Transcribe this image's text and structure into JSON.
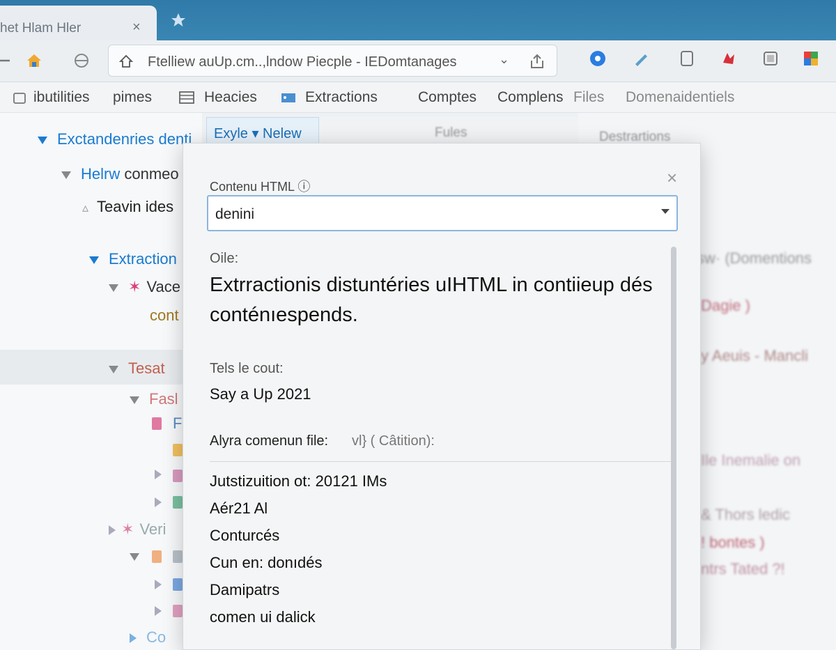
{
  "browser": {
    "tab_title": "het Hlam Hler",
    "tab_close": "×",
    "address": "Ftelliew auUp.cm..,lndow Piecple - IEDomtanages",
    "address_chevron": "⌄"
  },
  "bookmarks": [
    "ibutilities",
    "pimes",
    "Heacies",
    "Extractions",
    "Comptes",
    "Complens",
    "Files",
    "Domenaidentiels"
  ],
  "tree": {
    "item1": "Exctandenries denti",
    "item2_prefix": "Helrw",
    "item2_rest": " conmeo",
    "item3": "Teavin ides",
    "item4": "Extraction",
    "item5": "Vace",
    "item6": "cont",
    "item7": "Tesat",
    "item8": "Fasl",
    "item9": "F",
    "item10": "Veri",
    "item11": "Co"
  },
  "toolbar": {
    "dialog_tab": "Exyle ▾ Nelew",
    "files": "Fules",
    "destinations": "Destrartions"
  },
  "right_panel": {
    "line1": "sw· (Domentions",
    "line2": "Dagie )",
    "line3": "y Aeuis - Mancli",
    "line4": "Ile Inemalie on",
    "line5": "& Thors ledic",
    "line6": "! bontes )",
    "line7": "ntrs Tated ?!"
  },
  "dialog": {
    "header_label": "Contenu HTML ⓘ",
    "close": "×",
    "select_value": "denini",
    "field1_label": "Oile:",
    "field1_value": "Extrractionis distuntéries uIHTML in contiieup dés conténıespends.",
    "field2_label": "Tels le cout:",
    "field2_value": "Say a Up 2021",
    "field3_label": "Alyra comenun file:",
    "field3_extra": "vl} ( Câtition):",
    "items": [
      "Jutstizuition ot: 20121 IMs",
      "Aér21 Al",
      "Conturcés",
      "Cun en: donıdés",
      "Damipatrs",
      "comen ui dalick"
    ]
  },
  "colors": {
    "titlebar": "#2f7aa8",
    "link_blue": "#1a7bd0",
    "select_border": "#8bb6df"
  }
}
